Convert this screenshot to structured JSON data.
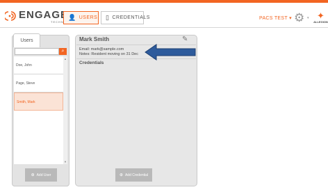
{
  "header": {
    "brand": "ENGAGE",
    "brand_sub": "TECHNOLOGY",
    "tabs": [
      {
        "label": "USERS",
        "icon": "user-icon",
        "active": true
      },
      {
        "label": "CREDENTIALS",
        "icon": "card-icon",
        "active": false
      }
    ],
    "site_name": "PACS TEST",
    "site_caret": "▾",
    "settings_icon": "gear-icon",
    "settings_caret": "▾",
    "vendor": "ALLEGION"
  },
  "users_panel": {
    "tab_label": "Users",
    "search": {
      "value": "",
      "placeholder": ""
    },
    "search_icon": "search-icon",
    "users": [
      "Doe, John",
      "Page, Steve",
      "Smith, Mark"
    ],
    "selected_user": "Smith, Mark",
    "add_button": "Add User"
  },
  "detail_panel": {
    "name": "Mark Smith",
    "email_line": "Email: mark@sample.com",
    "notes_line": "Notes: Resident moving on 31 Dec",
    "credentials_heading": "Credentials",
    "add_button": "Add Credential",
    "edit_icon": "edit-icon"
  },
  "colors": {
    "accent": "#f26522",
    "arrow": "#2e5b9c"
  }
}
